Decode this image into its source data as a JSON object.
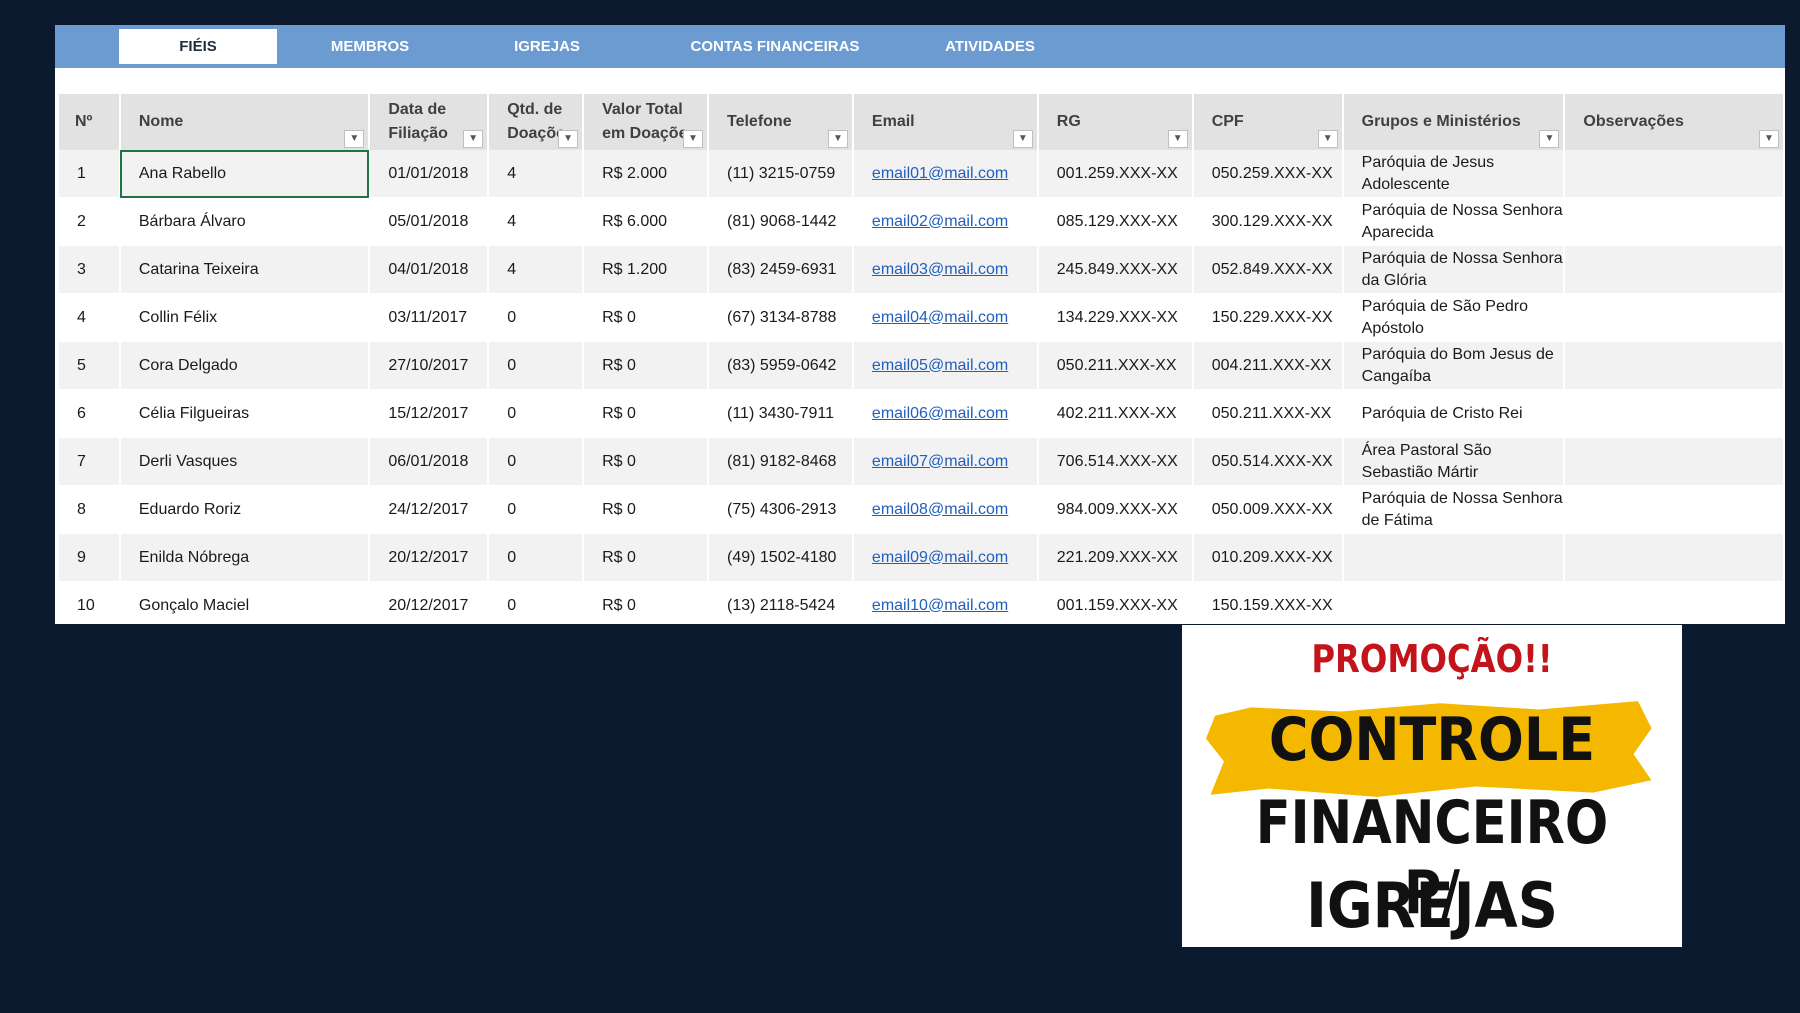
{
  "tabs": [
    {
      "label": "FIÉIS"
    },
    {
      "label": "MEMBROS"
    },
    {
      "label": "IGREJAS"
    },
    {
      "label": "CONTAS FINANCEIRAS"
    },
    {
      "label": "ATIVIDADES"
    }
  ],
  "active_tab": "FIÉIS",
  "columns": {
    "num": "Nº",
    "nome": "Nome",
    "data_l1": "Data de",
    "data_l2": "Filiação",
    "qtd_l1": "Qtd. de",
    "qtd_l2": "Doaçõe",
    "valor_l1": "Valor Total",
    "valor_l2": "em Doaçõe",
    "telefone": "Telefone",
    "email": "Email",
    "rg": "RG",
    "cpf": "CPF",
    "grupos": "Grupos e Ministérios",
    "obs": "Observações"
  },
  "rows": [
    {
      "num": "1",
      "nome": "Ana Rabello",
      "data": "01/01/2018",
      "qtd": "4",
      "valor": "R$ 2.000",
      "tel": "(11) 3215-0759",
      "email": "email01@mail.com",
      "rg": "001.259.XXX-XX",
      "cpf": "050.259.XXX-XX",
      "grupos": "Paróquia de Jesus Adolescente",
      "obs": ""
    },
    {
      "num": "2",
      "nome": "Bárbara Álvaro",
      "data": "05/01/2018",
      "qtd": "4",
      "valor": "R$ 6.000",
      "tel": "(81) 9068-1442",
      "email": "email02@mail.com",
      "rg": "085.129.XXX-XX",
      "cpf": "300.129.XXX-XX",
      "grupos": "Paróquia de Nossa Senhora Aparecida",
      "obs": ""
    },
    {
      "num": "3",
      "nome": "Catarina Teixeira",
      "data": "04/01/2018",
      "qtd": "4",
      "valor": "R$ 1.200",
      "tel": "(83) 2459-6931",
      "email": "email03@mail.com",
      "rg": "245.849.XXX-XX",
      "cpf": "052.849.XXX-XX",
      "grupos": "Paróquia de Nossa Senhora da Glória",
      "obs": ""
    },
    {
      "num": "4",
      "nome": "Collin Félix",
      "data": "03/11/2017",
      "qtd": "0",
      "valor": "R$ 0",
      "tel": "(67) 3134-8788",
      "email": "email04@mail.com",
      "rg": "134.229.XXX-XX",
      "cpf": "150.229.XXX-XX",
      "grupos": "Paróquia de São Pedro Apóstolo",
      "obs": ""
    },
    {
      "num": "5",
      "nome": "Cora Delgado",
      "data": "27/10/2017",
      "qtd": "0",
      "valor": "R$ 0",
      "tel": "(83) 5959-0642",
      "email": "email05@mail.com",
      "rg": "050.211.XXX-XX",
      "cpf": "004.211.XXX-XX",
      "grupos": "Paróquia do Bom Jesus de Cangaíba",
      "obs": ""
    },
    {
      "num": "6",
      "nome": "Célia Filgueiras",
      "data": "15/12/2017",
      "qtd": "0",
      "valor": "R$ 0",
      "tel": "(11) 3430-7911",
      "email": "email06@mail.com",
      "rg": "402.211.XXX-XX",
      "cpf": "050.211.XXX-XX",
      "grupos": "Paróquia de Cristo Rei",
      "obs": ""
    },
    {
      "num": "7",
      "nome": "Derli Vasques",
      "data": "06/01/2018",
      "qtd": "0",
      "valor": "R$ 0",
      "tel": "(81) 9182-8468",
      "email": "email07@mail.com",
      "rg": "706.514.XXX-XX",
      "cpf": "050.514.XXX-XX",
      "grupos": "Área Pastoral São Sebastião Mártir",
      "obs": ""
    },
    {
      "num": "8",
      "nome": "Eduardo Roriz",
      "data": "24/12/2017",
      "qtd": "0",
      "valor": "R$ 0",
      "tel": "(75) 4306-2913",
      "email": "email08@mail.com",
      "rg": "984.009.XXX-XX",
      "cpf": "050.009.XXX-XX",
      "grupos": "Paróquia de Nossa Senhora de Fátima",
      "obs": ""
    },
    {
      "num": "9",
      "nome": "Enilda Nóbrega",
      "data": "20/12/2017",
      "qtd": "0",
      "valor": "R$ 0",
      "tel": "(49) 1502-4180",
      "email": "email09@mail.com",
      "rg": "221.209.XXX-XX",
      "cpf": "010.209.XXX-XX",
      "grupos": "",
      "obs": ""
    },
    {
      "num": "10",
      "nome": "Gonçalo Maciel",
      "data": "20/12/2017",
      "qtd": "0",
      "valor": "R$ 0",
      "tel": "(13) 2118-5424",
      "email": "email10@mail.com",
      "rg": "001.159.XXX-XX",
      "cpf": "150.159.XXX-XX",
      "grupos": "",
      "obs": ""
    }
  ],
  "promo": {
    "top": "PROMOÇÃO!!",
    "line1": "CONTROLE",
    "line2": "FINANCEIRO P/",
    "line3": "IGREJAS"
  },
  "colors": {
    "tabbar": "#6c9bd2",
    "header_bg": "#e2e2e2",
    "link": "#1f5fbf",
    "promo_red": "#c4141b",
    "promo_yellow": "#f5b800",
    "background": "#0b1a2e"
  },
  "icons": {
    "filter": "filter-dropdown-icon"
  }
}
